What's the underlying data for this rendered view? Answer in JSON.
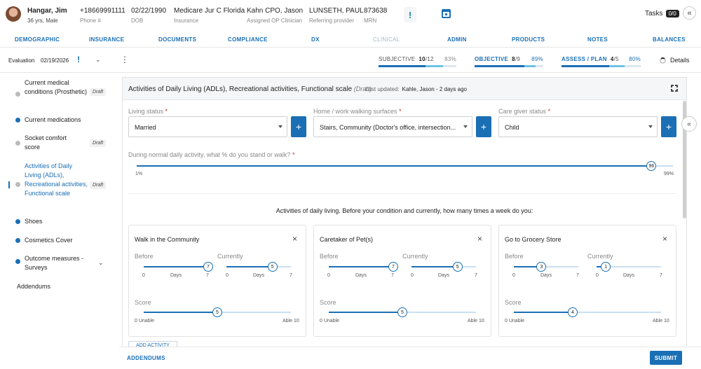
{
  "patient": {
    "name": "Hangar, Jim",
    "age_sex": "36 yrs, Male",
    "phone": "+18669991111",
    "phone_label": "Phone #",
    "dob": "02/22/1990",
    "dob_label": "DOB",
    "insurance": "Medicare Jur C Florida",
    "insurance_label": "Insurance",
    "clinician": "Kahn CPO, Jason",
    "clinician_label": "Assigned OP Clinician",
    "referrer": "LUNSETH, PAUL",
    "referrer_label": "Referring provider",
    "mrn": "873638",
    "mrn_label": "MRN"
  },
  "header": {
    "alert_icon": "!",
    "tasks_label": "Tasks",
    "tasks_count": "0/0",
    "collapse_icon": "«"
  },
  "nav": [
    "DEMOGRAPHIC",
    "INSURANCE",
    "DOCUMENTS",
    "COMPLIANCE",
    "DX",
    "CLINICAL",
    "ADMIN",
    "PRODUCTS",
    "NOTES",
    "BALANCES"
  ],
  "toolbar": {
    "type": "Evaluation",
    "date": "02/19/2026",
    "bang": "!",
    "chevron": "⌄",
    "kebab": "⋮",
    "details": "Details"
  },
  "progress": [
    {
      "label": "SUBJECTIVE",
      "count": "10",
      "total": "/12",
      "pct": "83%",
      "fraction": 0.83,
      "color": "#555"
    },
    {
      "label": "OBJECTIVE",
      "count": "8",
      "total": "/9",
      "pct": "89%",
      "fraction": 0.89,
      "color": "#1a6fb5"
    },
    {
      "label": "ASSESS / PLAN",
      "count": "4",
      "total": "/5",
      "pct": "80%",
      "fraction": 0.8,
      "color": "#1a6fb5"
    }
  ],
  "sidebar": {
    "items": [
      {
        "label": "Current medical conditions (Prosthetic)",
        "status": "gray",
        "draft": "Draft"
      },
      {
        "label": "Current medications",
        "status": "ok",
        "draft": ""
      },
      {
        "label": "Socket comfort score",
        "status": "gray",
        "draft": "Draft"
      },
      {
        "label": "Activities of Daily Living (ADLs), Recreational activities, Functional scale",
        "status": "gray",
        "draft": "Draft"
      },
      {
        "label": "Shoes",
        "status": "ok",
        "draft": ""
      },
      {
        "label": "Cosmetics Cover",
        "status": "ok",
        "draft": ""
      },
      {
        "label": "Outcome measures - Surveys",
        "status": "ok",
        "draft": ""
      }
    ],
    "addendums": "Addendums",
    "expand_icon": "⌄"
  },
  "panel": {
    "title": "Activities of Daily Living (ADLs), Recreational activities, Functional scale",
    "status": "(Draft)",
    "updated_label": "Last updated:",
    "updated_value": "Kahle, Jason - 2 days ago",
    "living_label": "Living status",
    "living_value": "Married",
    "walking_label": "Home / work walking surfaces",
    "walking_value": "Stairs, Community (Doctor's office, intersection...",
    "caregiver_label": "Care giver status",
    "caregiver_value": "Child",
    "req": "*",
    "plus": "+",
    "stand_label": "During normal daily activity, what % do you stand or walk?",
    "stand_value": "96",
    "stand_fraction": 0.96,
    "stand_min": "1%",
    "stand_max": "99%",
    "adl_question": "Activities of daily living. Before your condition and currently, how many times a week do you:",
    "add_activity": "ADD ACTIVITY"
  },
  "cards": [
    {
      "title": "Walk in the Community",
      "before": "7",
      "before_frac": 1.0,
      "current": "5",
      "current_frac": 0.714,
      "score": "5",
      "score_frac": 0.5
    },
    {
      "title": "Caretaker of Pet(s)",
      "before": "7",
      "before_frac": 1.0,
      "current": "5",
      "current_frac": 0.714,
      "score": "5",
      "score_frac": 0.5
    },
    {
      "title": "Go to Grocery Store",
      "before": "3",
      "before_frac": 0.429,
      "current": "1",
      "current_frac": 0.143,
      "score": "4",
      "score_frac": 0.4
    }
  ],
  "card_labels": {
    "before": "Before",
    "currently": "Currently",
    "score": "Score",
    "zero": "0",
    "days": "Days",
    "seven": "7",
    "unable": "0 Unable",
    "able": "Able 10",
    "close": "×"
  },
  "footer": {
    "addendums": "ADDENDUMS",
    "submit": "SUBMIT"
  },
  "colors": {
    "accent": "#1a6fb5",
    "accent_light": "#6ec1e4"
  }
}
